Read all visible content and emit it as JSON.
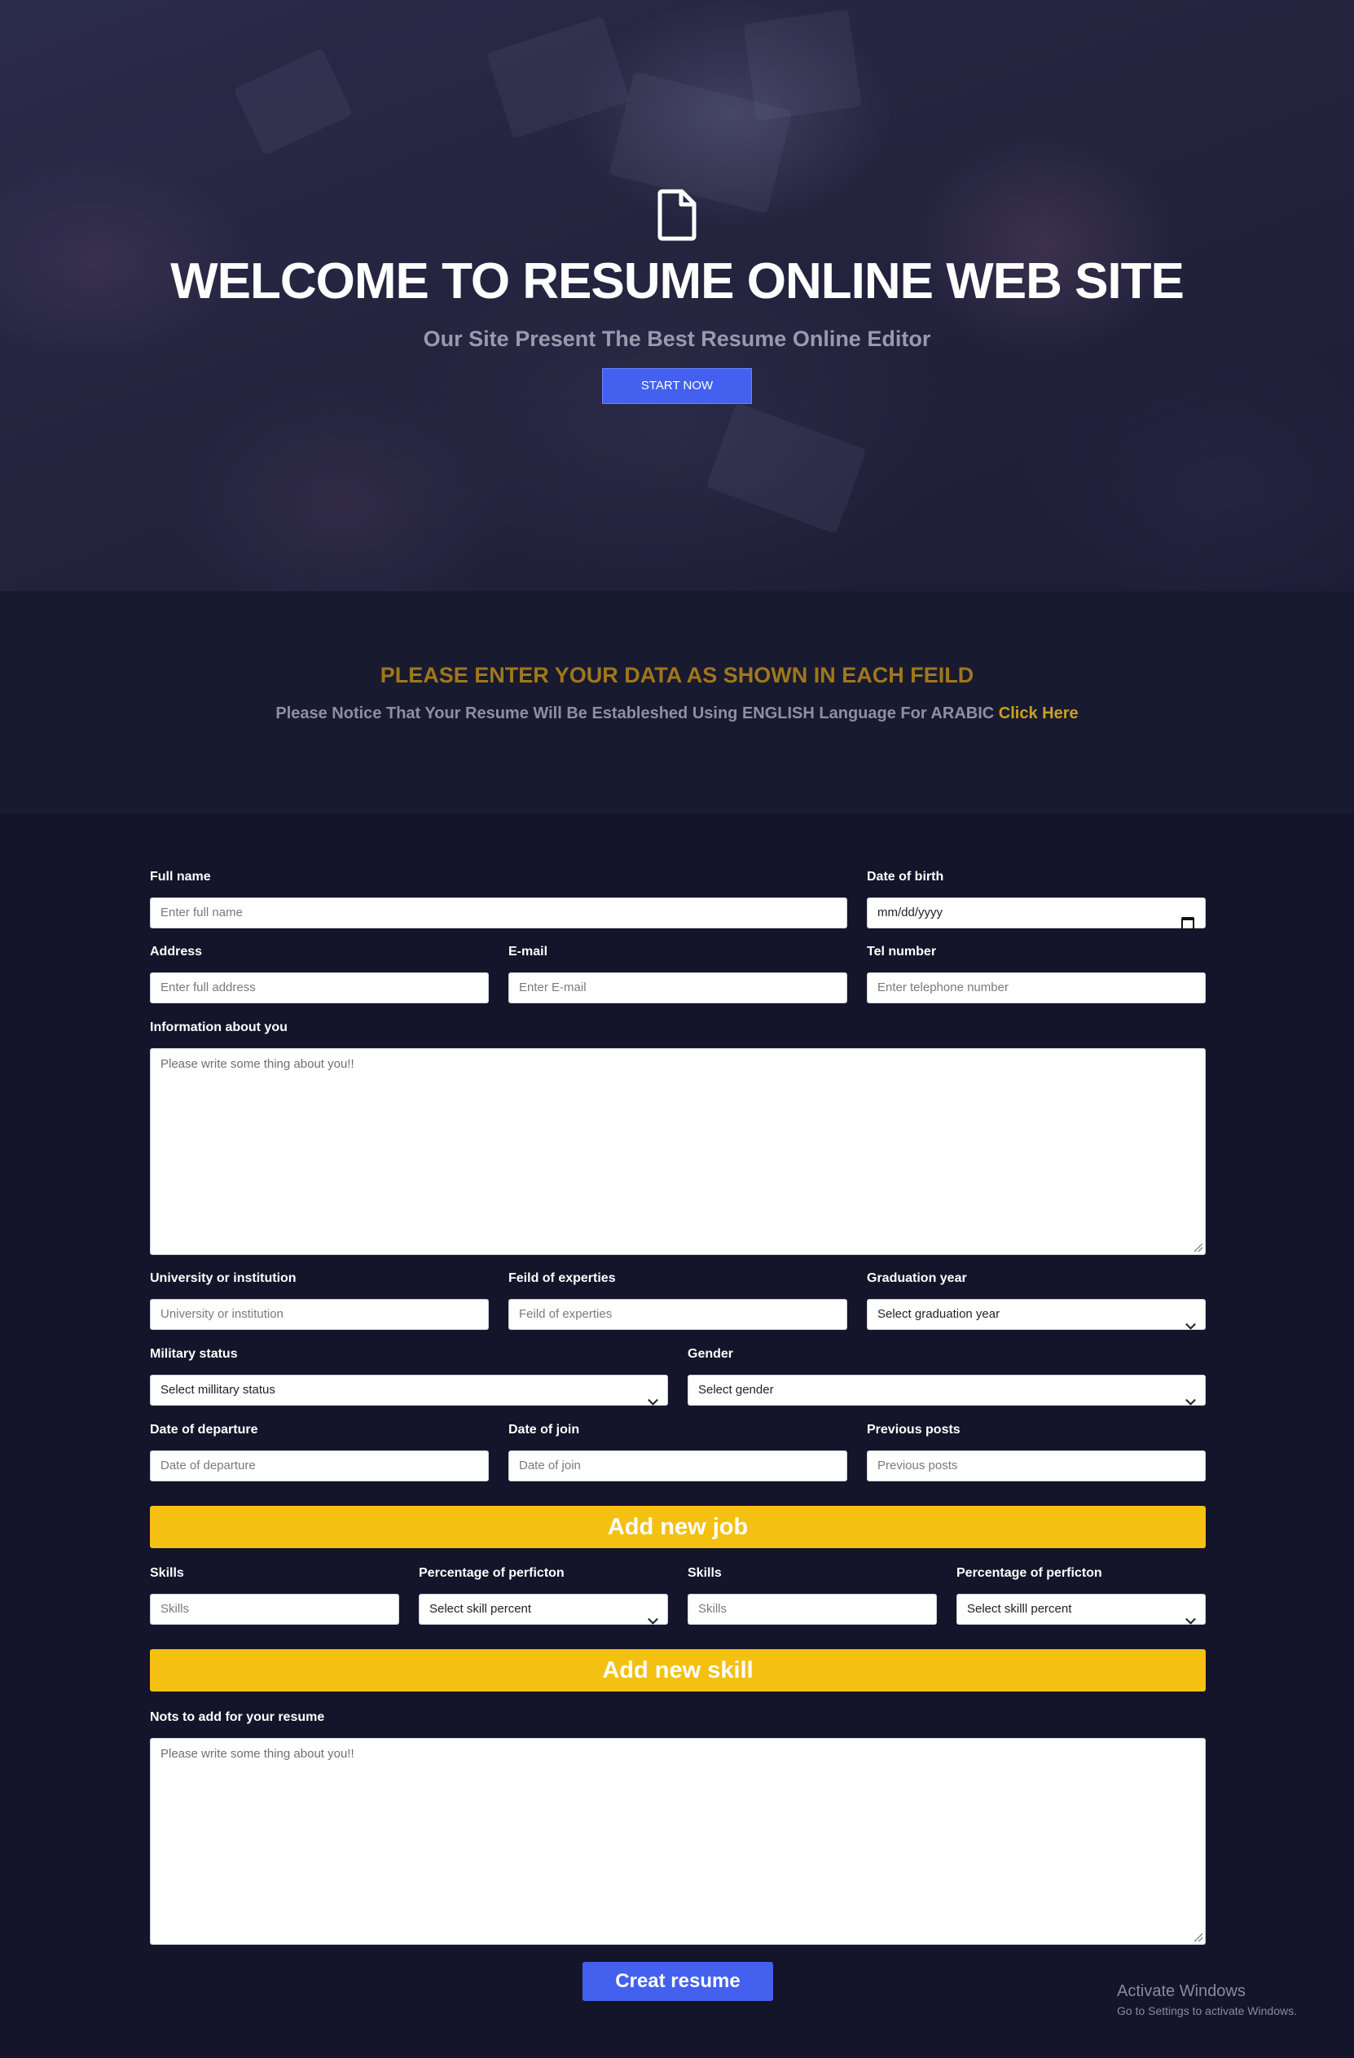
{
  "hero": {
    "icon": "document-icon",
    "title": "WELCOME TO RESUME ONLINE WEB SITE",
    "subtitle": "Our Site Present The Best Resume Online Editor",
    "start_button": "START NOW"
  },
  "notice": {
    "title": "PLEASE ENTER YOUR DATA AS SHOWN IN EACH FEILD",
    "text": "Please Notice That Your Resume Will Be Estableshed Using ENGLISH Language For ARABIC",
    "link": "Click Here"
  },
  "form": {
    "full_name": {
      "label": "Full name",
      "placeholder": "Enter full name"
    },
    "date_of_birth": {
      "label": "Date of birth",
      "value": "mm/dd/yyyy"
    },
    "address": {
      "label": "Address",
      "placeholder": "Enter full address"
    },
    "email": {
      "label": "E-mail",
      "placeholder": "Enter E-mail"
    },
    "tel": {
      "label": "Tel number",
      "placeholder": "Enter telephone number"
    },
    "info": {
      "label": "Information about you",
      "placeholder": "Please write some thing about you!!"
    },
    "university": {
      "label": "University or institution",
      "placeholder": "University or institution"
    },
    "field_of_expertise": {
      "label": "Feild of experties",
      "placeholder": "Feild of experties"
    },
    "graduation_year": {
      "label": "Graduation year",
      "value": "Select graduation year"
    },
    "military_status": {
      "label": "Military status",
      "value": "Select millitary status"
    },
    "gender": {
      "label": "Gender",
      "value": "Select gender"
    },
    "date_of_departure": {
      "label": "Date of departure",
      "placeholder": "Date of departure"
    },
    "date_of_join": {
      "label": "Date of join",
      "placeholder": "Date of join"
    },
    "previous_posts": {
      "label": "Previous posts",
      "placeholder": "Previous posts"
    },
    "add_job_button": "Add new job",
    "skill_1": {
      "label": "Skills",
      "placeholder": "Skills"
    },
    "percent_1": {
      "label": "Percentage of perficton",
      "value": "Select skill percent"
    },
    "skill_2": {
      "label": "Skills",
      "placeholder": "Skills"
    },
    "percent_2": {
      "label": "Percentage of perficton",
      "value": "Select skilll percent"
    },
    "add_skill_button": "Add new skill",
    "notes": {
      "label": "Nots to add for your resume",
      "placeholder": "Please write some thing about you!!"
    },
    "create_button": "Creat resume"
  },
  "watermark": {
    "line1": "Activate Windows",
    "line2": "Go to Settings to activate Windows."
  },
  "colors": {
    "accent_blue": "#4361ee",
    "accent_yellow": "#f4c011",
    "notice_gold": "#a0771a",
    "page_bg": "#14142a"
  }
}
